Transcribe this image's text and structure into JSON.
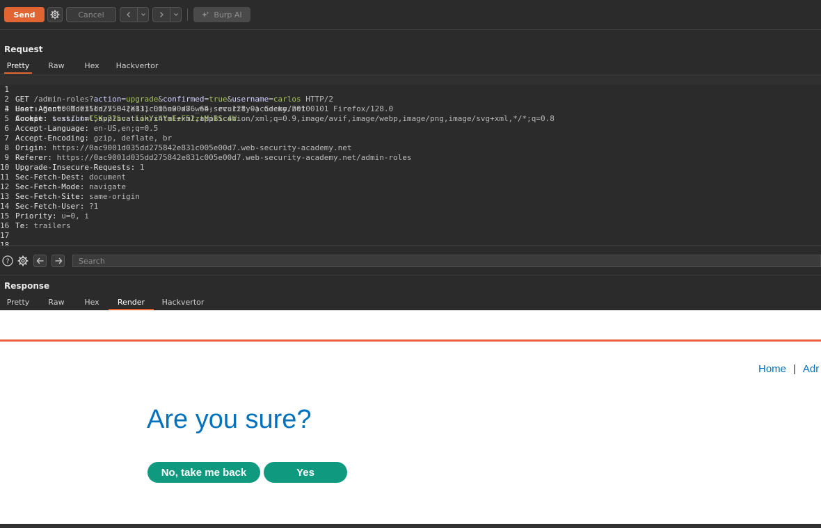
{
  "toolbar": {
    "send_label": "Send",
    "cancel_label": "Cancel",
    "burp_ai_label": "Burp AI"
  },
  "request": {
    "title": "Request",
    "tabs": [
      "Pretty",
      "Raw",
      "Hex",
      "Hackvertor"
    ],
    "active_tab": "Pretty",
    "lines": [
      {
        "n": "1",
        "method": "GET",
        "path": "/admin-roles?",
        "params": [
          [
            "action",
            "upgrade"
          ],
          [
            "confirmed",
            "true"
          ],
          [
            "username",
            "carlos"
          ]
        ],
        "proto": "HTTP/2"
      },
      {
        "n": "2",
        "key": "Host",
        "value": "0ac9001d035dd275842e831c005e00d7.web-security-academy.net"
      },
      {
        "n": "3",
        "key": "Cookie",
        "cookie_name": "session",
        "cookie_value": "C5Kv22bvatLikYi4YaEzF52ztMiBSc4W"
      },
      {
        "n": "4",
        "key": "User-Agent",
        "value": "Mozilla/5.0 (X11; Linux x86_64; rv:128.0) Gecko/20100101 Firefox/128.0"
      },
      {
        "n": "5",
        "key": "Accept",
        "value": "text/html,application/xhtml+xml,application/xml;q=0.9,image/avif,image/webp,image/png,image/svg+xml,*/*;q=0.8"
      },
      {
        "n": "6",
        "key": "Accept-Language",
        "value": "en-US,en;q=0.5"
      },
      {
        "n": "7",
        "key": "Accept-Encoding",
        "value": "gzip, deflate, br"
      },
      {
        "n": "8",
        "key": "Origin",
        "value": "https://0ac9001d035dd275842e831c005e00d7.web-security-academy.net"
      },
      {
        "n": "9",
        "key": "Referer",
        "value": "https://0ac9001d035dd275842e831c005e00d7.web-security-academy.net/admin-roles"
      },
      {
        "n": "10",
        "key": "Upgrade-Insecure-Requests",
        "value": "1"
      },
      {
        "n": "11",
        "key": "Sec-Fetch-Dest",
        "value": "document"
      },
      {
        "n": "12",
        "key": "Sec-Fetch-Mode",
        "value": "navigate"
      },
      {
        "n": "13",
        "key": "Sec-Fetch-Site",
        "value": "same-origin"
      },
      {
        "n": "14",
        "key": "Sec-Fetch-User",
        "value": "?1"
      },
      {
        "n": "15",
        "key": "Priority",
        "value": "u=0, i"
      },
      {
        "n": "16",
        "key": "Te",
        "value": "trailers"
      },
      {
        "n": "17"
      },
      {
        "n": "18"
      }
    ]
  },
  "search": {
    "placeholder": "Search"
  },
  "response": {
    "title": "Response",
    "tabs": [
      "Pretty",
      "Raw",
      "Hex",
      "Render",
      "Hackvertor"
    ],
    "active_tab": "Render"
  },
  "rendered_page": {
    "nav_home": "Home",
    "nav_separator": "|",
    "nav_admin": "Adr",
    "heading": "Are you sure?",
    "back_button": "No, take me back",
    "yes_button": "Yes",
    "link_color": "#0071bc",
    "button_color": "#0f9a80",
    "accent_line_color": "#e8613c"
  },
  "colors": {
    "send": "#e06533",
    "panel_bg": "#2b2b2b"
  }
}
